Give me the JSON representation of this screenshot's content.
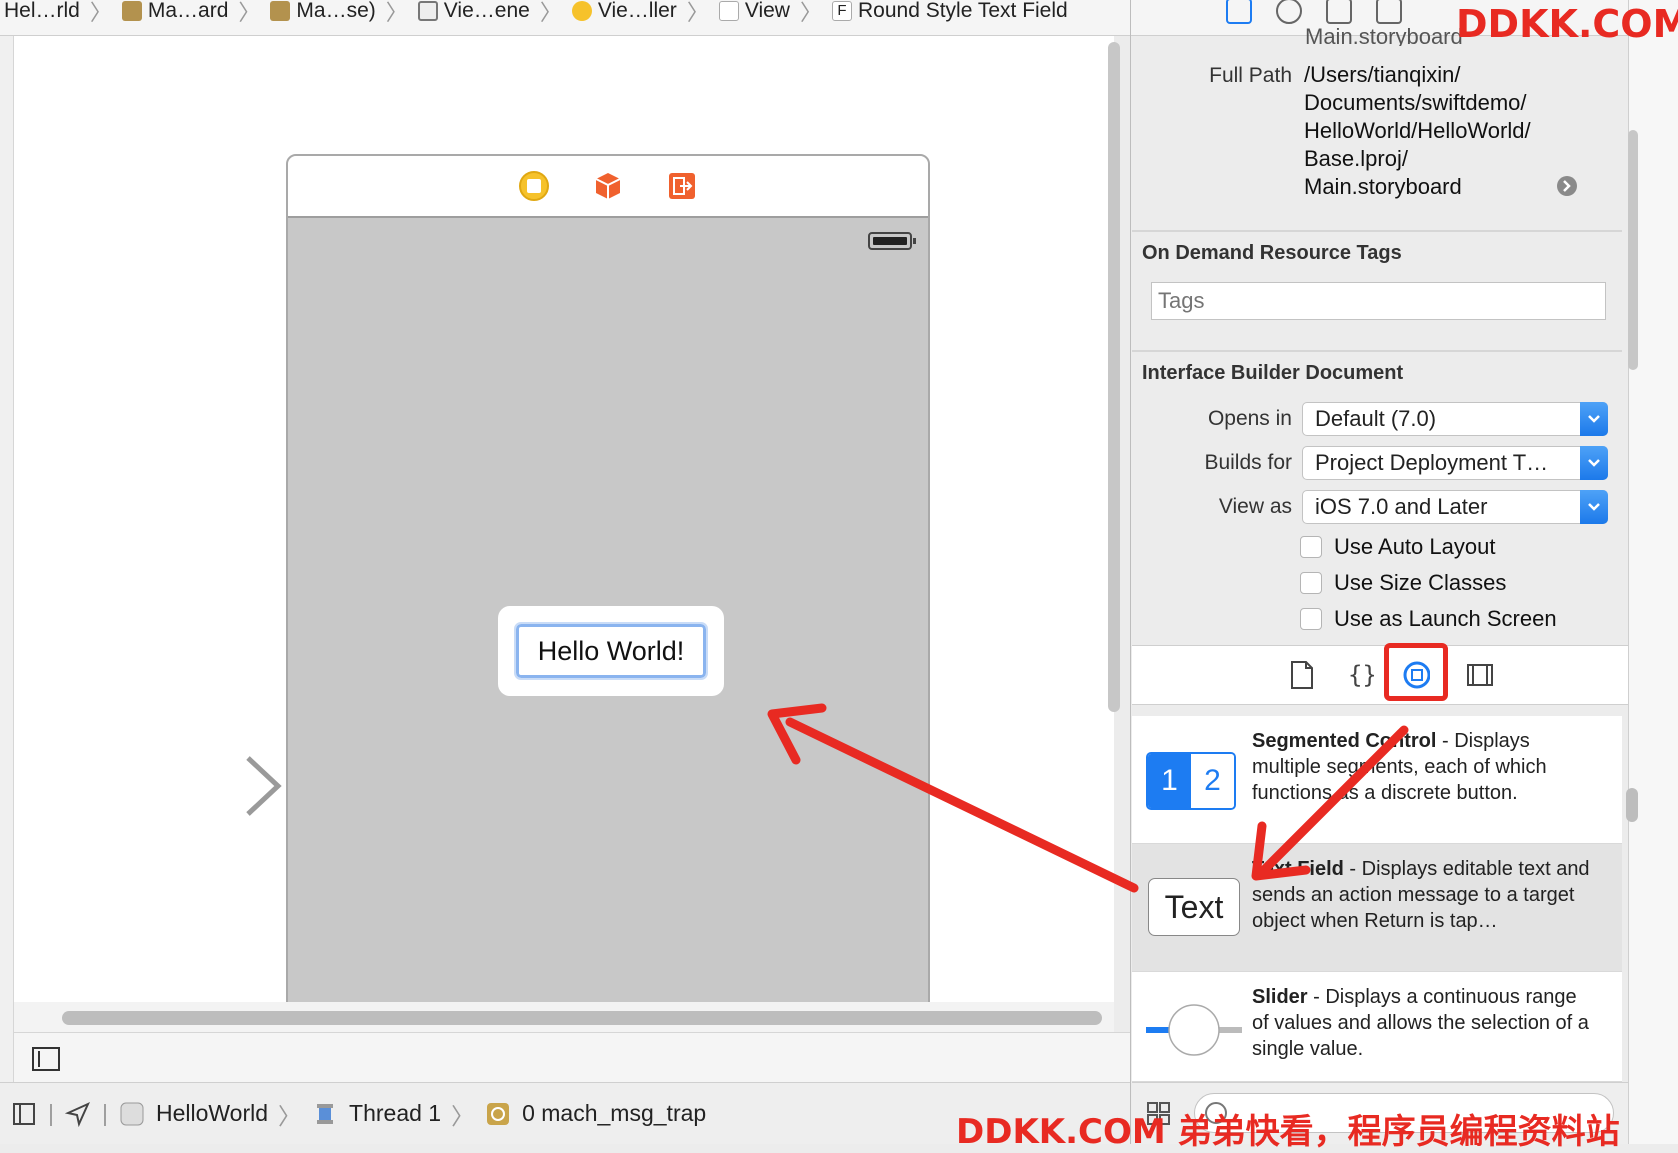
{
  "breadcrumb": [
    {
      "label": "Hel…rld",
      "icon": "project-icon"
    },
    {
      "label": "Ma…ard",
      "icon": "folder-icon"
    },
    {
      "label": "Ma…se)",
      "icon": "storyboard-icon"
    },
    {
      "label": "Vie…ene",
      "icon": "scene-icon"
    },
    {
      "label": "Vie…ller",
      "icon": "view-controller-icon"
    },
    {
      "label": "View",
      "icon": "view-icon"
    },
    {
      "label": "Round Style Text Field",
      "icon": "text-field-f-icon",
      "icon_text": "F"
    }
  ],
  "canvas": {
    "text_field_value": "Hello World!"
  },
  "debug_bar": {
    "target": "HelloWorld",
    "thread": "Thread 1",
    "frame": "0 mach_msg_trap"
  },
  "inspector": {
    "partial_top_text": "Main.storyboard",
    "full_path_label": "Full Path",
    "full_path_lines": [
      "/Users/tianqixin/",
      "Documents/swiftdemo/",
      "HelloWorld/HelloWorld/",
      "Base.lproj/",
      "Main.storyboard"
    ],
    "odr_title": "On Demand Resource Tags",
    "tags_placeholder": "Tags",
    "ib_title": "Interface Builder Document",
    "opens_in_label": "Opens in",
    "opens_in_value": "Default (7.0)",
    "builds_for_label": "Builds for",
    "builds_for_value": "Project Deployment T…",
    "view_as_label": "View as",
    "view_as_value": "iOS 7.0 and Later",
    "checkboxes": [
      "Use Auto Layout",
      "Use Size Classes",
      "Use as Launch Screen"
    ]
  },
  "library": {
    "items": [
      {
        "name": "Segmented Control",
        "desc": " - Displays multiple segments, each of which functions as a discrete button.",
        "thumb_1": "1",
        "thumb_2": "2"
      },
      {
        "name": "Text Field",
        "desc": " - Displays editable text and sends an action message to a target object when Return is tap…",
        "thumb": "Text"
      },
      {
        "name": "Slider",
        "desc": " - Displays a continuous range of values and allows the selection of a single value."
      }
    ]
  },
  "watermark": {
    "top": "DDKK.COM",
    "bottom": "DDKK.COM 弟弟快看，程序员编程资料站"
  },
  "colors": {
    "accent": "#1d7cf2",
    "annotation_red": "#e82a22"
  }
}
